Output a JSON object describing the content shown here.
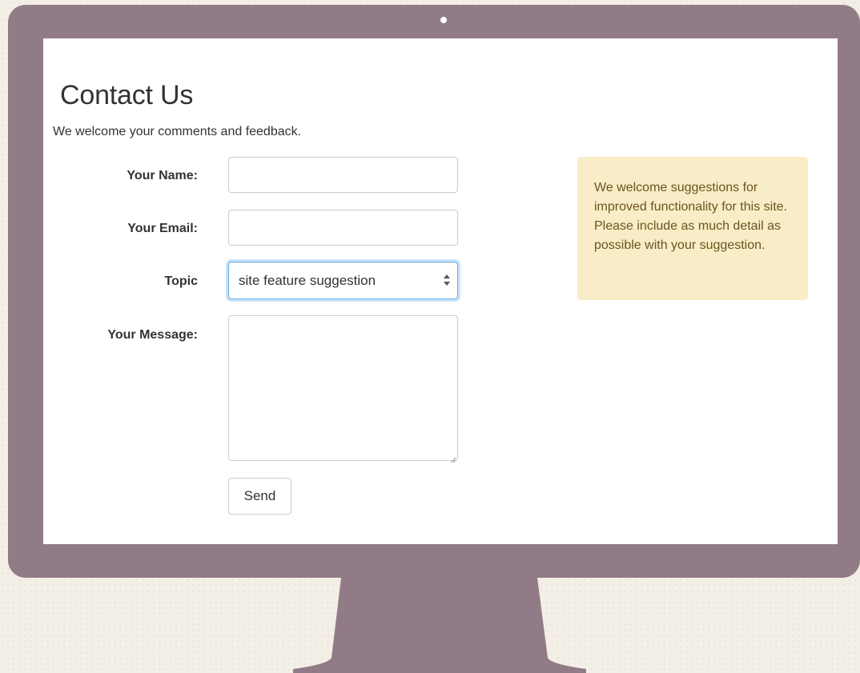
{
  "page": {
    "title": "Contact Us",
    "intro": "We welcome your comments and feedback."
  },
  "form": {
    "name_label": "Your Name:",
    "name_value": "",
    "email_label": "Your Email:",
    "email_value": "",
    "topic_label": "Topic",
    "topic_selected": "site feature suggestion",
    "message_label": "Your Message:",
    "message_value": "",
    "send_label": "Send"
  },
  "info_panel": {
    "text": "We welcome suggestions for improved functionality for this site. Please include as much detail as possible with your suggestion."
  },
  "colors": {
    "monitor": "#917b86",
    "background": "#f3efe6",
    "info_panel_bg": "#f8edc6",
    "info_panel_text": "#6d5420",
    "focus_border": "#66afe9"
  },
  "icons": {
    "select_arrows": "select-arrows-icon",
    "resize_grip": "resize-grip-icon"
  }
}
